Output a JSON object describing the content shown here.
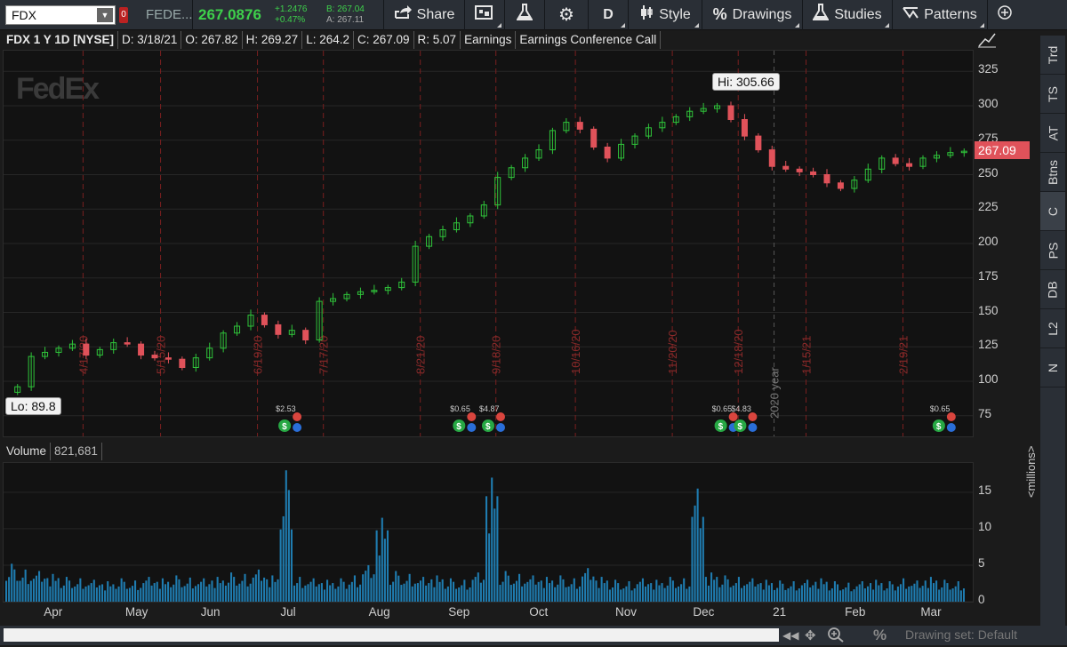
{
  "toolbar": {
    "symbol": "FDX",
    "link_badge": "0",
    "quote_name": "FEDE...",
    "last": "267.0876",
    "change": "+1.2476",
    "change_pct": "+0.47%",
    "bid": "B: 267.04",
    "ask": "A: 267.11",
    "share_label": "Share",
    "aggregation": "D",
    "style_label": "Style",
    "drawings_label": "Drawings",
    "studies_label": "Studies",
    "patterns_label": "Patterns"
  },
  "chart_header": {
    "title": "FDX 1 Y 1D [NYSE]",
    "date": "D: 3/18/21",
    "open": "O: 267.82",
    "high": "H: 269.27",
    "low": "L: 264.2",
    "close": "C: 267.09",
    "range": "R: 5.07",
    "earnings": "Earnings",
    "conf_call": "Earnings Conference Call"
  },
  "watermark": "FedEx",
  "callouts": {
    "hi": "Hi: 305.66",
    "lo": "Lo: 89.8",
    "last_price": "267.09"
  },
  "volume_header": {
    "label": "Volume",
    "value": "821,681"
  },
  "volume_unit": "<millions>",
  "price_axis": [
    325,
    300,
    275,
    250,
    225,
    200,
    175,
    150,
    125,
    100,
    75
  ],
  "volume_axis": [
    15,
    10,
    5,
    0
  ],
  "months": [
    "Apr",
    "May",
    "Jun",
    "Jul",
    "Aug",
    "Sep",
    "Oct",
    "Nov",
    "Dec",
    "21",
    "Feb",
    "Mar"
  ],
  "event_markers": [
    "4/17/20",
    "5/15/20",
    "6/19/20",
    "7/17/20",
    "8/21/20",
    "9/18/20",
    "10/16/20",
    "11/20/20",
    "12/18/20",
    "1/15/21",
    "2/19/21"
  ],
  "year_marker": "2020 year",
  "dividend_labels": [
    "$2.53",
    "$0.65",
    "$4.87",
    "$0.65",
    "$4.83",
    "$0.65"
  ],
  "right_tabs": [
    "Trd",
    "TS",
    "AT",
    "Btns",
    "C",
    "PS",
    "DB",
    "L2",
    "N"
  ],
  "bottom_bar": {
    "drawing_set": "Drawing set: Default"
  },
  "colors": {
    "up": "#2fc43a",
    "down": "#e0525a",
    "volume": "#1f7cb0",
    "accent": "#3ed04b"
  },
  "chart_data": {
    "type": "candlestick",
    "title": "FDX 1 Y 1D [NYSE]",
    "ylim": [
      60,
      340
    ],
    "x_months": [
      "Apr",
      "May",
      "Jun",
      "Jul",
      "Aug",
      "Sep",
      "Oct",
      "Nov",
      "Dec",
      "21",
      "Feb",
      "Mar"
    ],
    "close_weekly": [
      96,
      118,
      121,
      124,
      127,
      119,
      123,
      128,
      127,
      119,
      117,
      116,
      110,
      117,
      124,
      135,
      140,
      148,
      141,
      134,
      137,
      130,
      158,
      160,
      163,
      165,
      166,
      168,
      172,
      198,
      205,
      210,
      215,
      220,
      228,
      248,
      255,
      262,
      268,
      282,
      288,
      283,
      270,
      262,
      272,
      278,
      284,
      288,
      292,
      296,
      298,
      300,
      290,
      278,
      268,
      256,
      254,
      252,
      250,
      244,
      240,
      246,
      254,
      262,
      258,
      256,
      262,
      264,
      266,
      267
    ],
    "volume_weekly_millions": [
      5.2,
      4.4,
      4.2,
      3.8,
      3.4,
      3.2,
      3.0,
      2.8,
      3.2,
      2.9,
      3.4,
      3.2,
      3.6,
      3.3,
      3.2,
      3.4,
      4.0,
      3.8,
      4.4,
      3.6,
      18.0,
      3.4,
      3.2,
      3.0,
      3.2,
      3.6,
      5.0,
      11.5,
      4.2,
      3.8,
      3.4,
      3.6,
      3.2,
      3.0,
      4.0,
      17.0,
      4.2,
      3.8,
      3.6,
      3.4,
      3.6,
      3.2,
      4.6,
      3.4,
      3.0,
      2.8,
      3.2,
      3.0,
      3.4,
      3.2,
      15.5,
      4.0,
      3.6,
      3.4,
      3.2,
      3.0,
      2.9,
      2.8,
      3.0,
      3.2,
      2.8,
      2.6,
      2.8,
      3.0,
      2.8,
      3.2,
      2.9,
      3.4,
      3.0,
      2.8
    ],
    "hi": 305.66,
    "lo": 89.8,
    "last": 267.09
  }
}
